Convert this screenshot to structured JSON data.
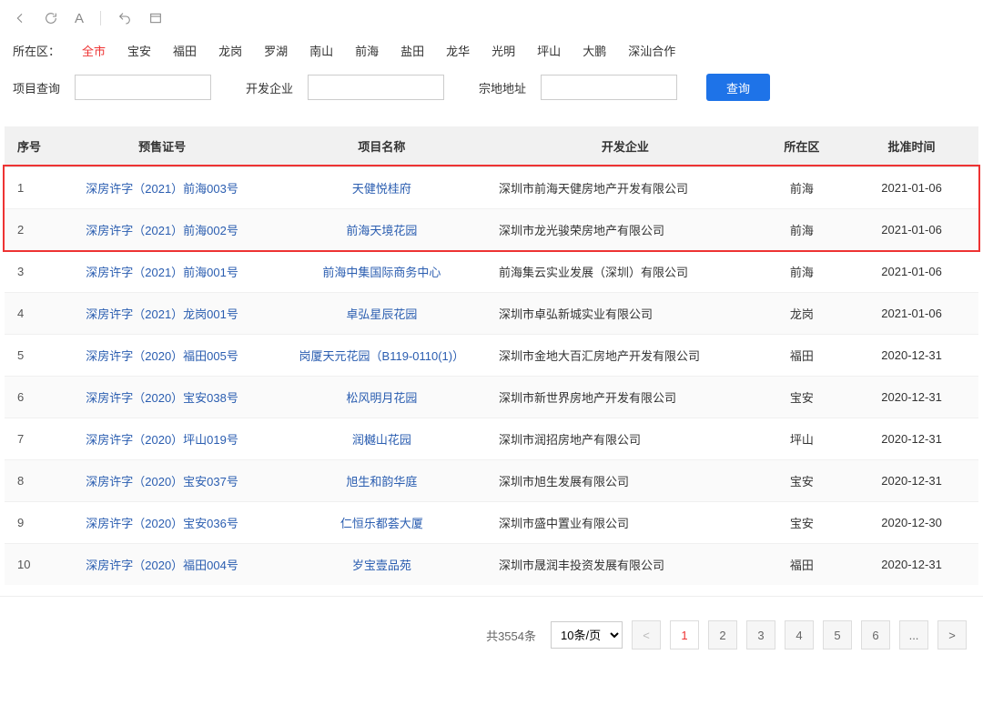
{
  "toolbar": {
    "letter": "A"
  },
  "districts": {
    "label": "所在区：",
    "active": "全市",
    "items": [
      "全市",
      "宝安",
      "福田",
      "龙岗",
      "罗湖",
      "南山",
      "前海",
      "盐田",
      "龙华",
      "光明",
      "坪山",
      "大鹏",
      "深汕合作"
    ]
  },
  "search": {
    "project_label": "项目查询",
    "developer_label": "开发企业",
    "parcel_label": "宗地地址",
    "project_value": "",
    "developer_value": "",
    "parcel_value": "",
    "submit_label": "查询"
  },
  "table": {
    "headers": [
      "序号",
      "预售证号",
      "项目名称",
      "开发企业",
      "所在区",
      "批准时间"
    ],
    "rows": [
      {
        "idx": "1",
        "cert": "深房许字（2021）前海003号",
        "project": "天健悦桂府",
        "developer": "深圳市前海天健房地产开发有限公司",
        "district": "前海",
        "date": "2021-01-06"
      },
      {
        "idx": "2",
        "cert": "深房许字（2021）前海002号",
        "project": "前海天境花园",
        "developer": "深圳市龙光骏荣房地产有限公司",
        "district": "前海",
        "date": "2021-01-06"
      },
      {
        "idx": "3",
        "cert": "深房许字（2021）前海001号",
        "project": "前海中集国际商务中心",
        "developer": "前海集云实业发展（深圳）有限公司",
        "district": "前海",
        "date": "2021-01-06"
      },
      {
        "idx": "4",
        "cert": "深房许字（2021）龙岗001号",
        "project": "卓弘星辰花园",
        "developer": "深圳市卓弘新城实业有限公司",
        "district": "龙岗",
        "date": "2021-01-06"
      },
      {
        "idx": "5",
        "cert": "深房许字（2020）福田005号",
        "project": "岗厦天元花园（B119-0110(1)）",
        "developer": "深圳市金地大百汇房地产开发有限公司",
        "district": "福田",
        "date": "2020-12-31"
      },
      {
        "idx": "6",
        "cert": "深房许字（2020）宝安038号",
        "project": "松风明月花园",
        "developer": "深圳市新世界房地产开发有限公司",
        "district": "宝安",
        "date": "2020-12-31"
      },
      {
        "idx": "7",
        "cert": "深房许字（2020）坪山019号",
        "project": "润樾山花园",
        "developer": "深圳市润招房地产有限公司",
        "district": "坪山",
        "date": "2020-12-31"
      },
      {
        "idx": "8",
        "cert": "深房许字（2020）宝安037号",
        "project": "旭生和韵华庭",
        "developer": "深圳市旭生发展有限公司",
        "district": "宝安",
        "date": "2020-12-31"
      },
      {
        "idx": "9",
        "cert": "深房许字（2020）宝安036号",
        "project": "仁恒乐都荟大厦",
        "developer": "深圳市盛中置业有限公司",
        "district": "宝安",
        "date": "2020-12-30"
      },
      {
        "idx": "10",
        "cert": "深房许字（2020）福田004号",
        "project": "岁宝壹品苑",
        "developer": "深圳市晟润丰投资发展有限公司",
        "district": "福田",
        "date": "2020-12-31"
      }
    ]
  },
  "pagination": {
    "total_text": "共3554条",
    "page_size_text": "10条/页",
    "prev": "<",
    "next": ">",
    "ellipsis": "...",
    "pages": [
      "1",
      "2",
      "3",
      "4",
      "5",
      "6"
    ],
    "active": "1"
  }
}
